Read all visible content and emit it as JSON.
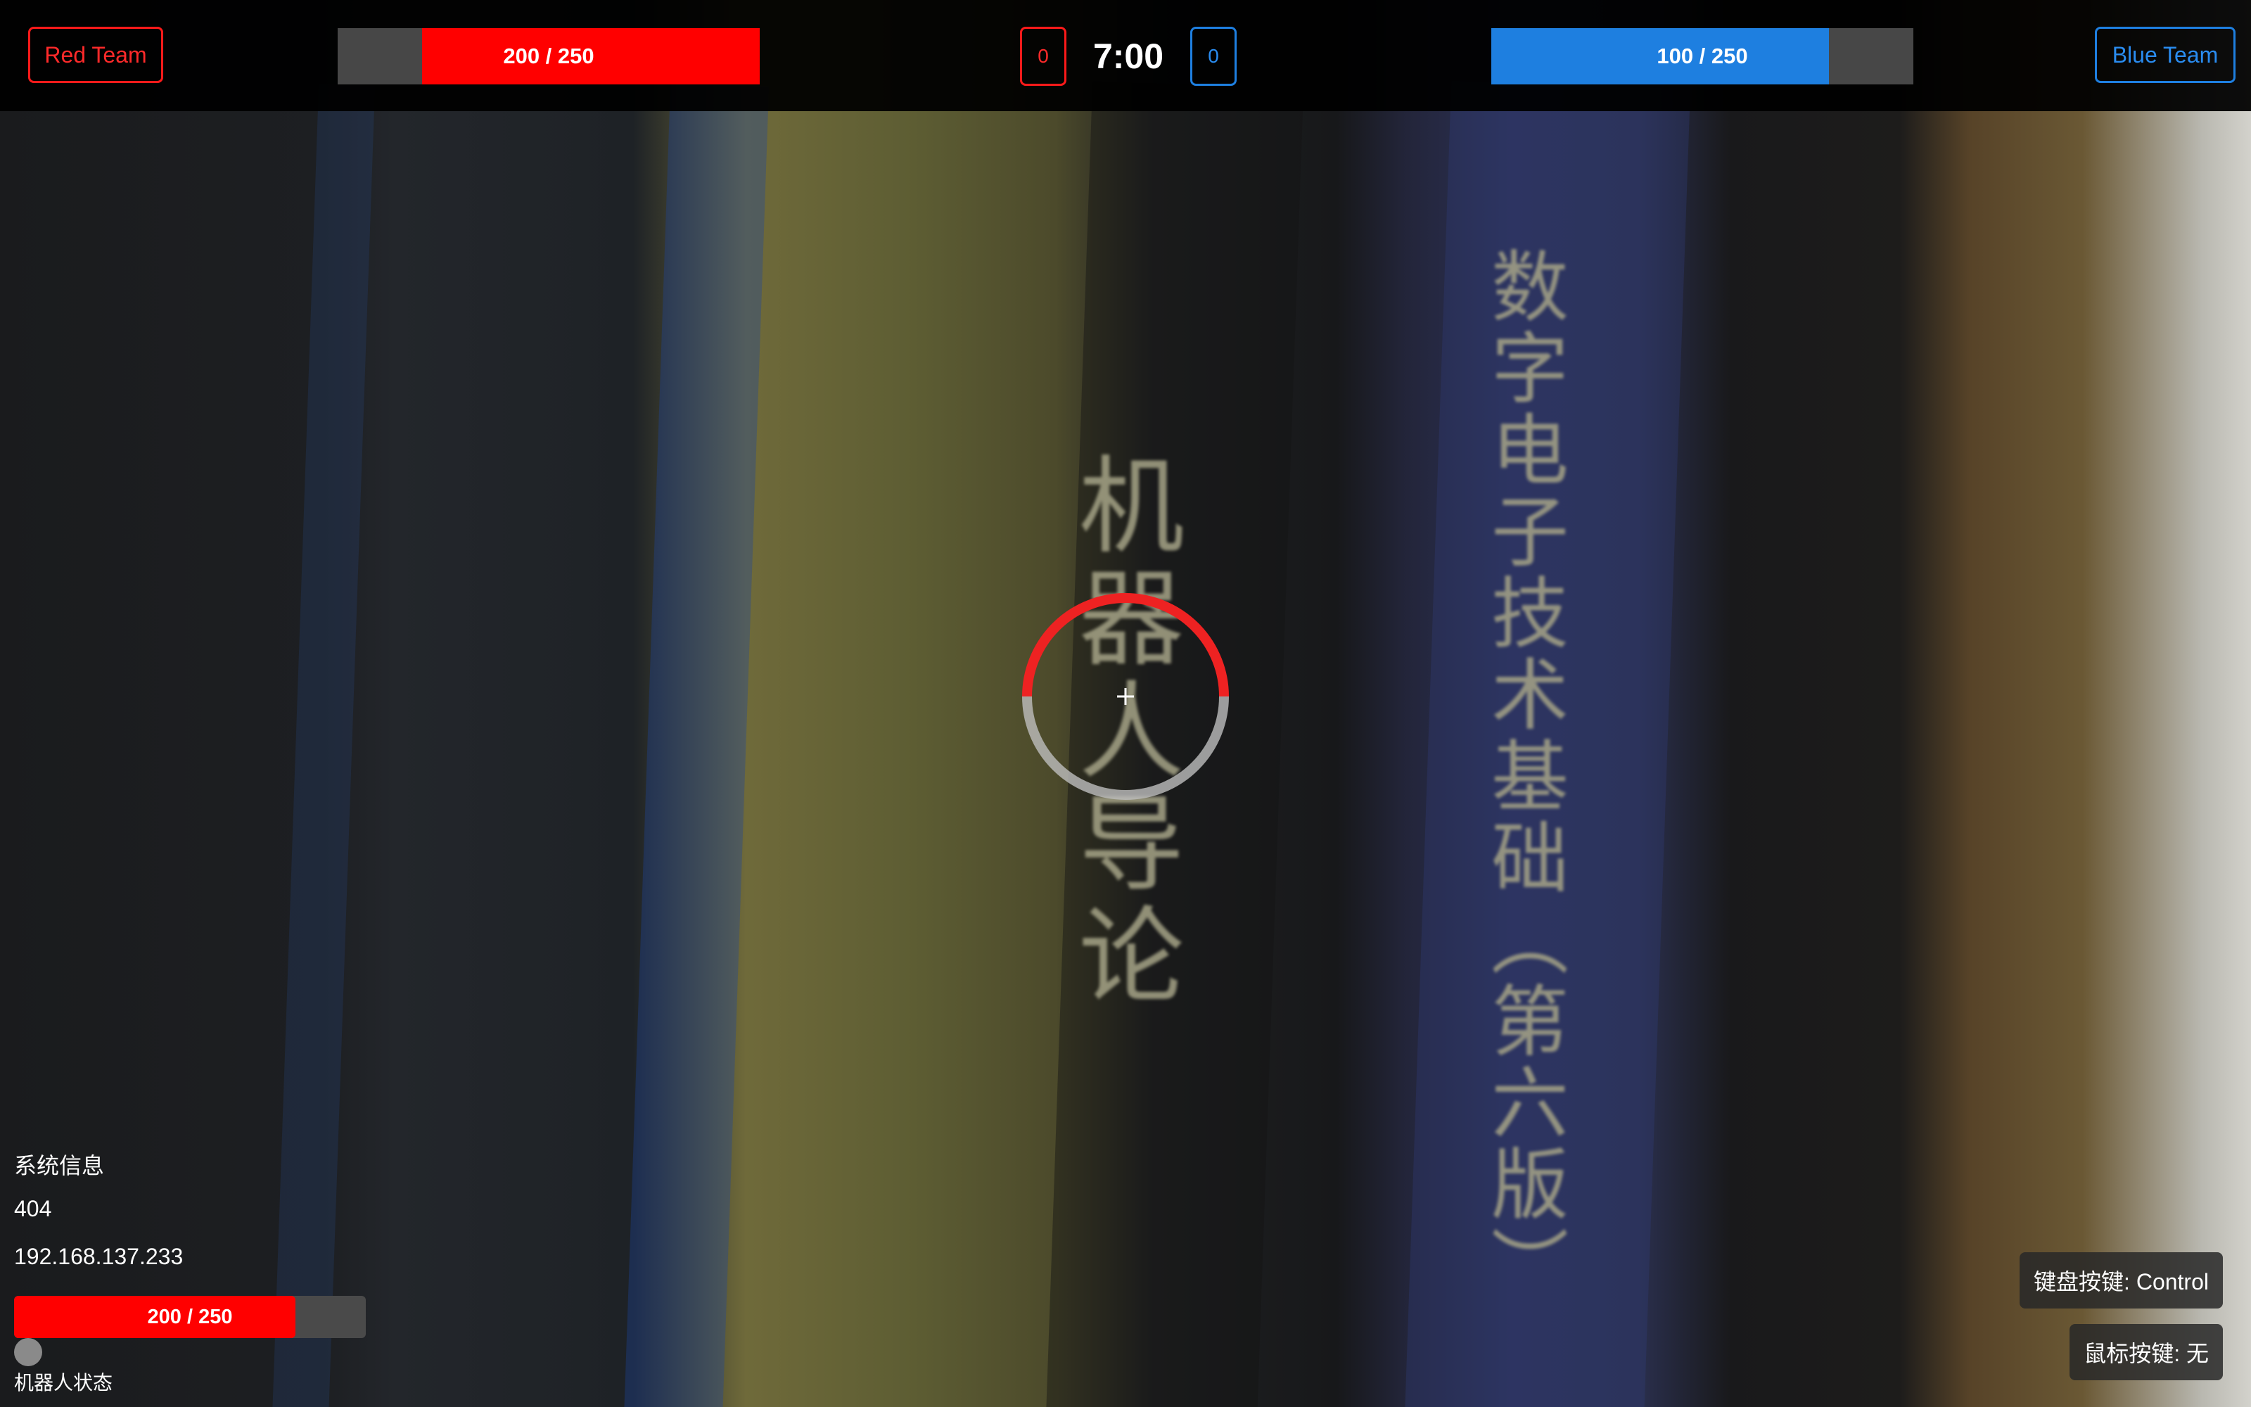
{
  "hud": {
    "red_team_label": "Red Team",
    "blue_team_label": "Blue Team",
    "red_hp_text": "200 / 250",
    "red_hp_fraction": 0.8,
    "blue_hp_text": "100 / 250",
    "blue_hp_fraction": 0.8,
    "red_score": "0",
    "blue_score": "0",
    "timer": "7:00"
  },
  "system_info": {
    "title": "系统信息",
    "code": "404",
    "ip": "192.168.137.233"
  },
  "robot": {
    "hp_text": "200 / 250",
    "hp_fraction": 0.8,
    "status_label": "机器人状态"
  },
  "keys": {
    "keyboard": "键盘按键: Control",
    "mouse": "鼠标按键: 无"
  },
  "camera_feed": {
    "book_title_1": "机器人导论",
    "book_title_2": "数字电子技术基础（第六版）"
  },
  "colors": {
    "red_accent": "#ff0000",
    "blue_accent": "#1e7fe0",
    "bar_background": "#474747"
  }
}
